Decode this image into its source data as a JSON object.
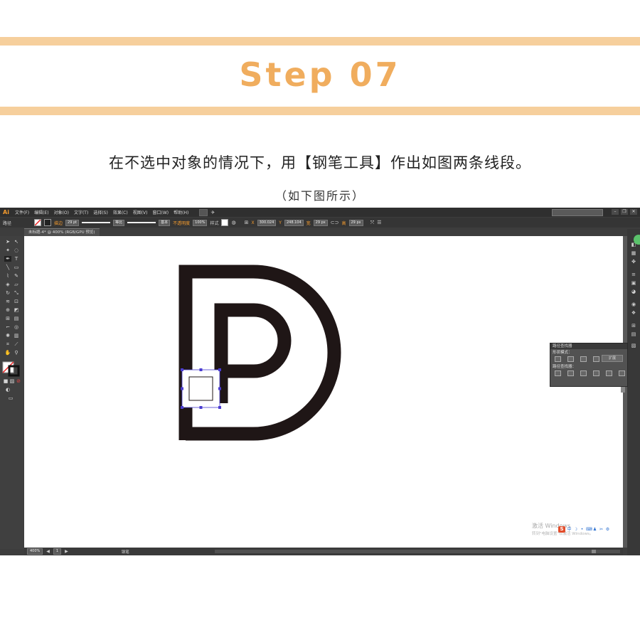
{
  "step_title": "Step 07",
  "instruction": "在不选中对象的情况下，用【钢笔工具】作出如图两条线段。",
  "sub_instruction": "（如下图所示）",
  "app": {
    "logo": "Ai",
    "menu": [
      "文件(F)",
      "编辑(E)",
      "对象(O)",
      "文字(T)",
      "选择(S)",
      "效果(C)",
      "视图(V)",
      "窗口(W)",
      "帮助(H)"
    ],
    "page_number": "1",
    "control_bar": {
      "selection_label": "路径",
      "stroke_label": "描边",
      "stroke_weight": "29 pt",
      "stroke_profile": "等比",
      "brush": "基本",
      "opacity_label": "不透明度",
      "opacity_value": "100%",
      "style_label": "样式",
      "x_value": "300.024",
      "y_value": "248.104",
      "w_value": "29 px",
      "h_value": "29 px"
    },
    "document_tab": "未标题-4* @ 400% (RGB/GPU 预览)",
    "status": {
      "zoom": "400%",
      "page": "1",
      "tool_name": "钢笔"
    },
    "pathfinder": {
      "title": "路径查找器",
      "shape_modes_label": "形状模式：",
      "expand_label": "扩展",
      "pathfinders_label": "路径查找器："
    },
    "watermark": {
      "title": "激活 Windows",
      "subtitle": "转到\"电脑设置\"以激活 Windows。"
    },
    "ime_label": "中"
  },
  "colors": {
    "accent_band": "#f6cf9c",
    "title_color": "#f0ad5e",
    "logo_stroke": "#1f1616",
    "selection": "#4a3cd0"
  }
}
